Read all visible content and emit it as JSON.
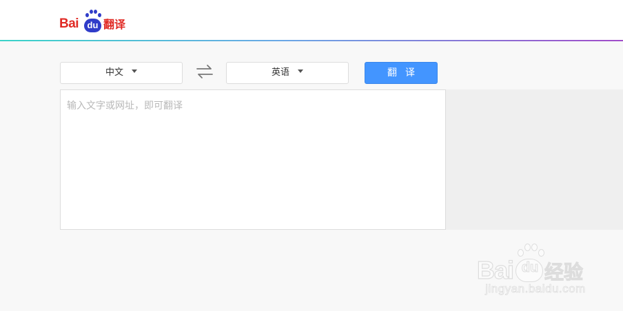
{
  "header": {
    "logo": {
      "bai": "Bai",
      "du": "du",
      "fanyi": "翻译"
    }
  },
  "toolbar": {
    "source_lang": "中文",
    "target_lang": "英语",
    "translate_label": "翻译"
  },
  "input": {
    "placeholder": "输入文字或网址，即可翻译",
    "value": ""
  },
  "watermark": {
    "bai": "Bai",
    "du": "du",
    "jingyan": "经验",
    "url": "jingyan.baidu.com"
  },
  "colors": {
    "brand_red": "#e02a24",
    "brand_blue": "#2f3cc9",
    "button_blue": "#4395ff"
  },
  "icons": [
    "swap-icon",
    "chevron-down-icon"
  ]
}
